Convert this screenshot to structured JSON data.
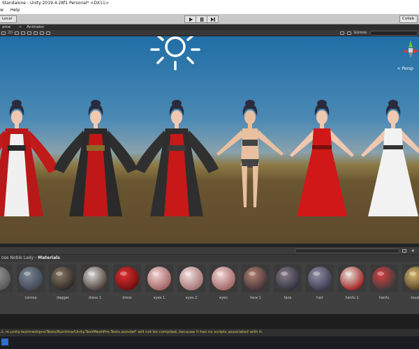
{
  "window": {
    "title": "Standalone - Unity 2019.4.28f1 Personal* <DX11>"
  },
  "menu": {
    "items": [
      "w",
      "Help"
    ]
  },
  "toolbar": {
    "local_label": "Local",
    "collab_label": "Collab"
  },
  "tabs": {
    "scene": "ame",
    "animator": "Animator"
  },
  "scene_toolbar": {
    "mode_2d": "2D",
    "gizmos": "Gizmos",
    "persp": "< Persp"
  },
  "breadcrumb": {
    "prefix": "ose Noble Lady",
    "separator": "›",
    "current": "Materials"
  },
  "materials": [
    {
      "label": "",
      "icon": "sphere-material-icon",
      "c1": "#9a9a9a",
      "c2": "#555555"
    },
    {
      "label": "cornea",
      "icon": "sphere-material-icon",
      "c1": "#7d8796",
      "c2": "#3c4450"
    },
    {
      "label": "dagger",
      "icon": "sphere-material-icon",
      "c1": "#8a7a66",
      "c2": "#2a2522"
    },
    {
      "label": "dress 1",
      "icon": "sphere-material-icon",
      "c1": "#d8d8d8",
      "c2": "#4a3a32"
    },
    {
      "label": "dress",
      "icon": "sphere-material-icon",
      "c1": "#e23030",
      "c2": "#6a0e0e"
    },
    {
      "label": "eyes 1",
      "icon": "sphere-material-icon",
      "c1": "#f1d0d0",
      "c2": "#a06060"
    },
    {
      "label": "eyes 2",
      "icon": "sphere-material-icon",
      "c1": "#f3dede",
      "c2": "#a07070"
    },
    {
      "label": "eyes",
      "icon": "sphere-material-icon",
      "c1": "#f3d4d4",
      "c2": "#9c6262"
    },
    {
      "label": "face 1",
      "icon": "sphere-material-icon",
      "c1": "#b38070",
      "c2": "#403036"
    },
    {
      "label": "face",
      "icon": "sphere-material-icon",
      "c1": "#8a7c86",
      "c2": "#2d2f3e"
    },
    {
      "label": "hair",
      "icon": "sphere-material-icon",
      "c1": "#9090a8",
      "c2": "#3a3a4e"
    },
    {
      "label": "hanfu 1",
      "icon": "sphere-material-icon",
      "c1": "#e8e0d8",
      "c2": "#9c1a1a"
    },
    {
      "label": "hanfu",
      "icon": "sphere-material-icon",
      "c1": "#d44040",
      "c2": "#3a3a3a"
    },
    {
      "label": "toushi",
      "icon": "sphere-material-icon",
      "c1": "#d8b870",
      "c2": "#4a3a22"
    }
  ],
  "status": {
    "message": "m.unity.textmeshpro/Tests/Runtime/Unity.TextMeshPro.Tests.asmdef' will not be compiled, because it has no scripts associated with it."
  },
  "figures": [
    {
      "kind": "robe",
      "robe": "#b81818",
      "under": "#f0f0f0",
      "sash": "#2a2a2a",
      "skin": "#f0c8b0",
      "sleeve": "#c01a1a"
    },
    {
      "kind": "robe",
      "robe": "#2a2a2a",
      "under": "#c01818",
      "sash": "#8a6a2a",
      "skin": "#f0c8b0",
      "sleeve": "#2e2e2e"
    },
    {
      "kind": "robe",
      "robe": "#2e2e2e",
      "under": "#c81818",
      "sash": "#3a3a3a",
      "skin": "#f0c8b0",
      "sleeve": "#303030"
    },
    {
      "kind": "body",
      "robe": "#444444",
      "under": "#444444",
      "sash": "#444444",
      "skin": "#e8c0a0",
      "sleeve": "#e8c0a0"
    },
    {
      "kind": "gown",
      "robe": "#d01818",
      "under": "#d01818",
      "sash": "#7a1010",
      "skin": "#f0c8b0",
      "sleeve": "#f0c8b0"
    },
    {
      "kind": "gown",
      "robe": "#f2f2f2",
      "under": "#f2f2f2",
      "sash": "#333333",
      "skin": "#f0c8b0",
      "sleeve": "#f0c8b0"
    }
  ]
}
